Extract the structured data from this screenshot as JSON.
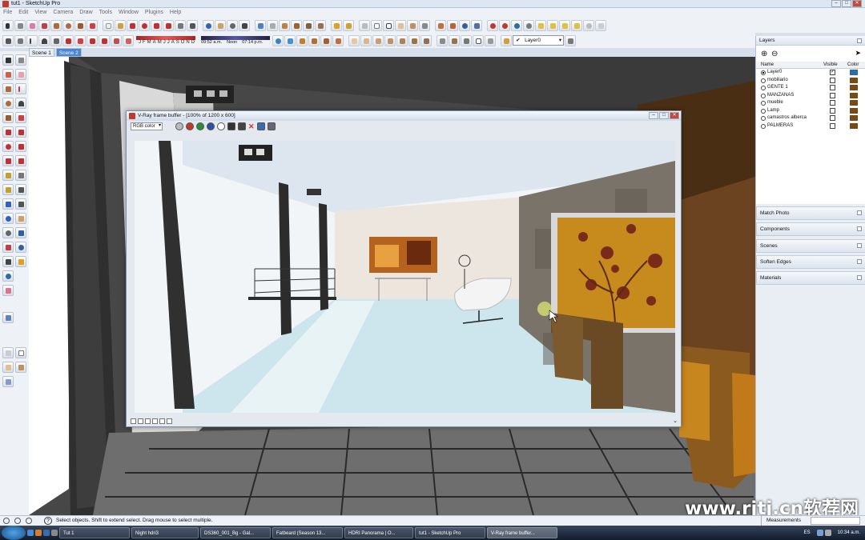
{
  "window": {
    "title": "tut1 - SketchUp Pro"
  },
  "menu": [
    "File",
    "Edit",
    "View",
    "Camera",
    "Draw",
    "Tools",
    "Window",
    "Plugins",
    "Help"
  ],
  "toolbar": {
    "months": [
      "J",
      "F",
      "M",
      "A",
      "M",
      "J",
      "J",
      "A",
      "S",
      "O",
      "N",
      "D"
    ],
    "time_left": "09:52 a.m.",
    "noon": "Noon",
    "time_right": "07:14 p.m.",
    "layer_value": "Layer0"
  },
  "scenes": [
    "Scene 1",
    "Scene 2"
  ],
  "active_scene": 1,
  "vray": {
    "title": "V-Ray frame buffer - [100% of 1200 x 600]",
    "channel": "RGB color",
    "colors": {
      "red": "#c0392b",
      "green": "#2e8b3a",
      "blue": "#2c4fa8"
    }
  },
  "layers": {
    "title": "Layers",
    "col_name": "Name",
    "col_visible": "Visible",
    "col_color": "Color",
    "items": [
      {
        "name": "Layer0",
        "visible": true,
        "color": "#2a6ea8"
      },
      {
        "name": "mobiliario",
        "visible": false,
        "color": "#7a4a14"
      },
      {
        "name": "GENTE 1",
        "visible": false,
        "color": "#7a4a14"
      },
      {
        "name": "MANZANAS",
        "visible": false,
        "color": "#7a4a14"
      },
      {
        "name": "mueble",
        "visible": false,
        "color": "#7a4a14"
      },
      {
        "name": "Lamp",
        "visible": false,
        "color": "#7a4a14"
      },
      {
        "name": "camastros alberca",
        "visible": false,
        "color": "#7a4a14"
      },
      {
        "name": "PALMERAS",
        "visible": false,
        "color": "#7a4a14"
      }
    ]
  },
  "panels": [
    "Match Photo",
    "Components",
    "Scenes",
    "Soften Edges",
    "Materials"
  ],
  "status": {
    "message": "Select objects. Shift to extend select. Drag mouse to select multiple.",
    "measurements": "Measurements"
  },
  "taskbar": {
    "items": [
      "Tut 1",
      "Night hdri3",
      "DS360_001_Bg - Gal...",
      "Fatbeard (Season 13...",
      "HDRI Panorama | O...",
      "tut1 - SketchUp Pro",
      "V-Ray frame buffer..."
    ],
    "lang": "ES",
    "clock": "10:34 a.m."
  },
  "watermark": "www.rjtj.cn软荐网"
}
